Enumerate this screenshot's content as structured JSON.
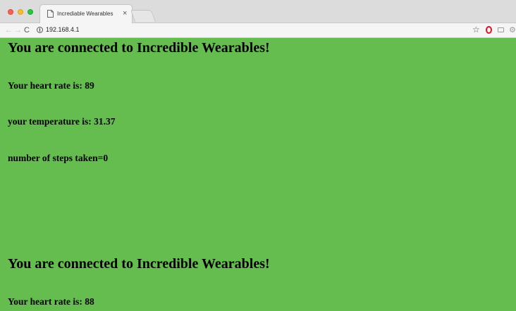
{
  "browser": {
    "tab_title": "Incrediable Wearables",
    "tab_close": "×",
    "url": "192.168.4.1",
    "icons": {
      "back": "back-arrow-icon",
      "forward": "forward-arrow-icon",
      "reload": "reload-icon",
      "site_info": "info-icon",
      "bookmark": "star-icon",
      "opera": "opera-icon",
      "cast": "cast-icon",
      "settings": "gear-icon"
    }
  },
  "page": {
    "background": "#65bc4f",
    "blocks": [
      {
        "heading": "You are connected to Incredible Wearables!",
        "heart_rate": "Your heart rate is: 89",
        "temperature": "your temperature is: 31.37",
        "steps": "number of steps taken=0"
      },
      {
        "heading": "You are connected to Incredible Wearables!",
        "heart_rate": "Your heart rate is: 88"
      }
    ]
  }
}
